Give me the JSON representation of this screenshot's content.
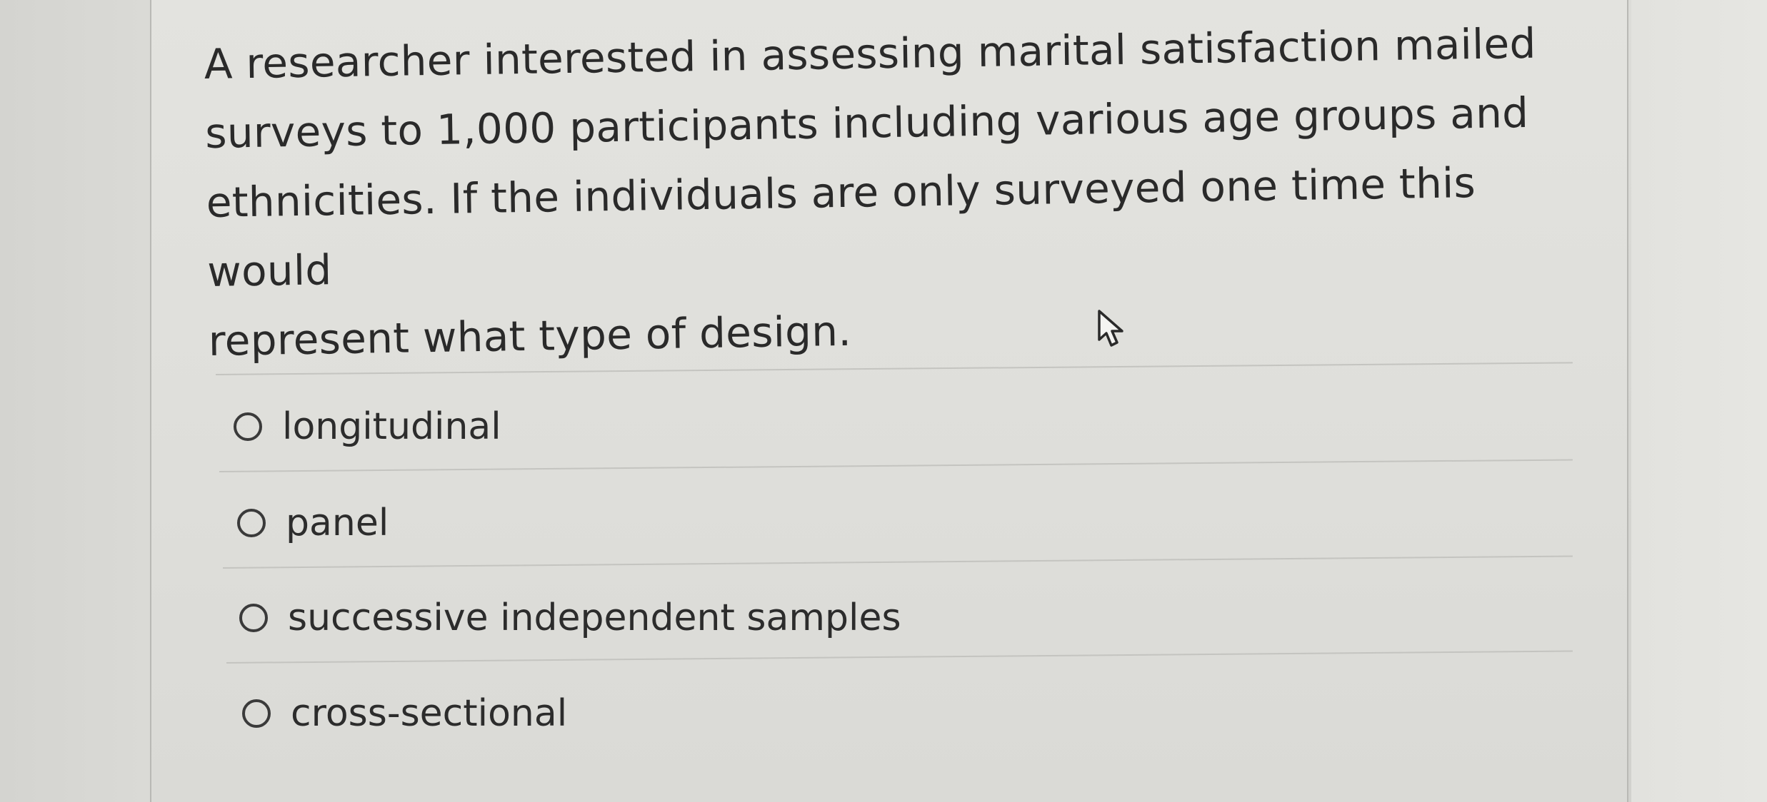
{
  "question": {
    "lines": [
      "A researcher interested in assessing marital satisfaction mailed",
      "surveys to 1,000 participants including various age groups and",
      "ethnicities. If the individuals are only surveyed one time this would",
      "represent what type of design."
    ]
  },
  "answers": [
    {
      "label": "longitudinal",
      "selected": false
    },
    {
      "label": "panel",
      "selected": false
    },
    {
      "label": "successive independent samples",
      "selected": false
    },
    {
      "label": "cross-sectional",
      "selected": false
    }
  ],
  "cursor": {
    "icon": "pointer-arrow-icon"
  }
}
